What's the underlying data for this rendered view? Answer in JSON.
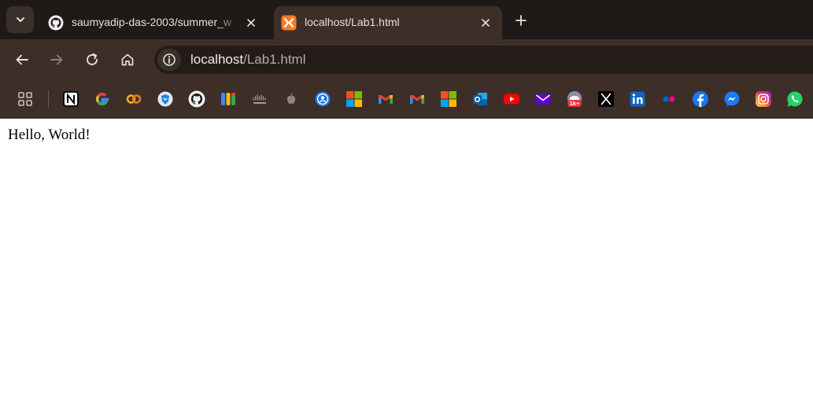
{
  "tabs": [
    {
      "title": "saumyadip-das-2003/summer_w",
      "favicon": "github-icon",
      "active": false
    },
    {
      "title": "localhost/Lab1.html",
      "favicon": "xampp-icon",
      "active": true
    }
  ],
  "address_bar": {
    "host": "localhost",
    "path": "/Lab1.html"
  },
  "bookmarks": [
    "notion-icon",
    "google-icon",
    "coursera-icon",
    "brave-icon",
    "github-icon",
    "google-meet-icon",
    "cisco-icon",
    "apple-icon",
    "account-icon",
    "microsoft-icon",
    "gmail-icon",
    "gmail-icon",
    "microsoft-icon",
    "outlook-icon",
    "youtube-icon",
    "yahoo-mail-icon",
    "reddit-icon",
    "x-icon",
    "linkedin-icon",
    "flickr-icon",
    "facebook-icon",
    "messenger-icon",
    "instagram-icon",
    "whatsapp-icon"
  ],
  "page": {
    "body_text": "Hello, World!"
  },
  "colors": {
    "tab_strip": "#1f1a18",
    "toolbar": "#3d2f28",
    "omnibox": "#241c19",
    "page_background": "#ffffff"
  }
}
